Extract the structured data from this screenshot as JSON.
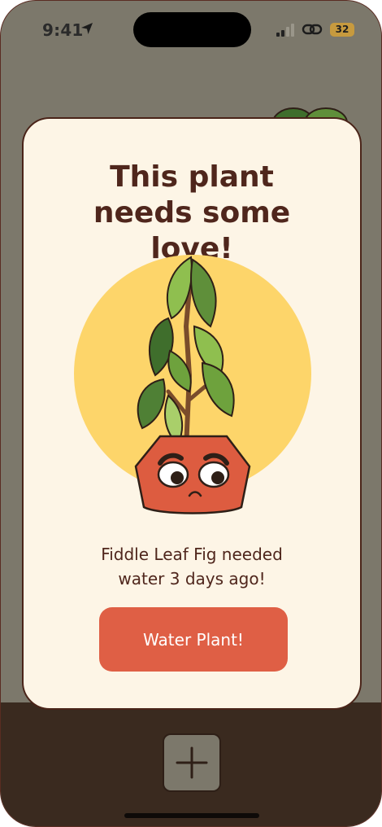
{
  "status_bar": {
    "time": "9:41",
    "battery": "32",
    "location_icon": "location-arrow-icon",
    "signal_icon": "cellular-signal-icon",
    "link_icon": "link-icon"
  },
  "modal": {
    "title": "This plant needs some love!",
    "message": "Fiddle Leaf Fig needed water 3 days ago!",
    "button_label": "Water Plant!"
  },
  "bottom_bar": {
    "add_icon": "plus-icon"
  },
  "colors": {
    "accent": "#df5f45",
    "text": "#4f261c",
    "modal_bg": "#fdf5e6",
    "sun": "#fdd56a",
    "pot": "#dd5c40",
    "leaf": "#6ea23d",
    "bottom_bar": "#3a2a1f"
  }
}
